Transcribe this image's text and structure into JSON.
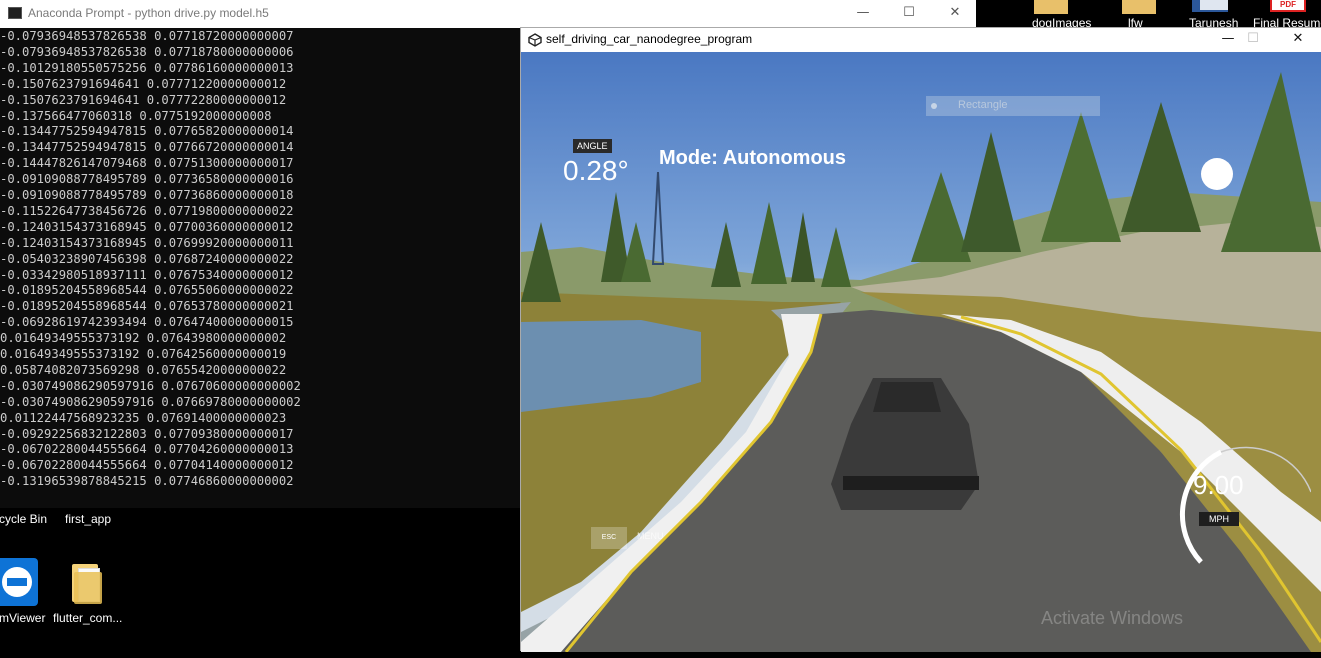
{
  "console": {
    "title": "Anaconda Prompt - python  drive.py model.h5",
    "minimize": "—",
    "maximize": "☐",
    "close": "✕",
    "lines": [
      "-0.07936948537826538 0.07718720000000007",
      "-0.07936948537826538 0.07718780000000006",
      "-0.10129180550575256 0.07786160000000013",
      "-0.1507623791694641 0.07771220000000012",
      "-0.1507623791694641 0.07772280000000012",
      "-0.137566477060318 0.0775192000000008",
      "-0.13447752594947815 0.07765820000000014",
      "-0.13447752594947815 0.07766720000000014",
      "-0.14447826147079468 0.07751300000000017",
      "-0.09109088778495789 0.07736580000000016",
      "-0.09109088778495789 0.07736860000000018",
      "-0.11522647738456726 0.07719800000000022",
      "-0.12403154373168945 0.07700360000000012",
      "-0.12403154373168945 0.07699920000000011",
      "-0.05403238907456398 0.07687240000000022",
      "-0.03342980518937111 0.07675340000000012",
      "-0.01895204558968544 0.07655060000000022",
      "-0.01895204558968544 0.07653780000000021",
      "-0.06928619742393494 0.07647400000000015",
      "0.01649349555373192 0.07643980000000002",
      "0.01649349555373192 0.07642560000000019",
      "0.05874082073569298 0.07655420000000022",
      "-0.030749086290597916 0.07670600000000002",
      "-0.030749086290597916 0.07669780000000002",
      "0.01122447568923235 0.07691400000000023",
      "-0.09292256832122803 0.07709380000000017",
      "-0.06702280044555664 0.07704260000000013",
      "-0.06702280044555664 0.07704140000000012",
      "-0.13196539878845215 0.07746860000000002"
    ]
  },
  "desktop": {
    "icons": [
      {
        "label": "cycle Bin"
      },
      {
        "label": "first_app"
      },
      {
        "label": "mViewer"
      },
      {
        "label": "flutter_com..."
      }
    ],
    "top_icons": [
      {
        "label": "dogImages"
      },
      {
        "label": "lfw"
      },
      {
        "label": "Tarunesh"
      },
      {
        "label": "Final Resume"
      }
    ],
    "pdf_label": "PDF"
  },
  "game": {
    "title": "self_driving_car_nanodegree_program",
    "minimize": "—",
    "maximize": "☐",
    "close": "✕",
    "hud": {
      "angle_label": "ANGLE",
      "angle_value": "0.28°",
      "mode": "Mode: Autonomous",
      "rect_label": "Rectangle",
      "speed_value": "9.00",
      "speed_unit": "MPH",
      "esc_label": "ESC",
      "menu_label": "MENU",
      "watermark": "Activate Windows"
    }
  }
}
